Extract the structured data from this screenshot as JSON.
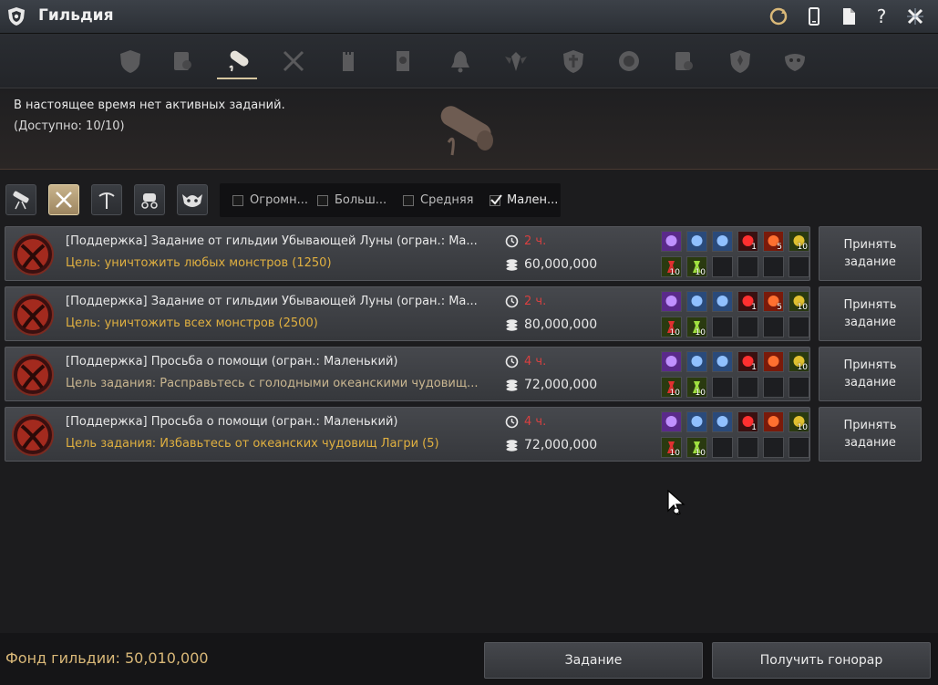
{
  "window": {
    "title": "Гильдия"
  },
  "header": {
    "no_task": "В настоящее время нет активных заданий.",
    "available": "(Доступно: 10/10)"
  },
  "filters": {
    "checkboxes": [
      {
        "label": "Огромн...",
        "checked": false
      },
      {
        "label": "Больш...",
        "checked": false
      },
      {
        "label": "Средняя",
        "checked": false
      },
      {
        "label": "Мален...",
        "checked": true
      }
    ]
  },
  "quests": [
    {
      "name": "[Поддержка] Задание от гильдии Убывающей Луны (огран.: Ма...",
      "goal": "Цель: уничтожить любых монстров (1250)",
      "goal_color": "#e0b040",
      "time": "2 ч.",
      "fee": "60,000,000",
      "counts": [
        "1",
        "5",
        "10",
        "10",
        "10"
      ],
      "accept": "Принять задание"
    },
    {
      "name": "[Поддержка] Задание от гильдии Убывающей Луны (огран.: Ма...",
      "goal": "Цель: уничтожить всех монстров (2500)",
      "goal_color": "#e0b040",
      "time": "2 ч.",
      "fee": "80,000,000",
      "counts": [
        "1",
        "5",
        "10",
        "10",
        "10"
      ],
      "accept": "Принять задание"
    },
    {
      "name": "[Поддержка] Просьба о помощи (огран.: Маленький)",
      "goal": "Цель задания: Расправьтесь с голодными океанскими чудовищ...",
      "goal_color": "#c9b690",
      "time": "4 ч.",
      "fee": "72,000,000",
      "counts": [
        "1",
        "",
        "10",
        "10",
        "10"
      ],
      "accept": "Принять задание"
    },
    {
      "name": "[Поддержка] Просьба о помощи (огран.: Маленький)",
      "goal": "Цель задания: Избавьтесь от океанских чудовищ Лагри (5)",
      "goal_color": "#e0b040",
      "time": "4 ч.",
      "fee": "72,000,000",
      "counts": [
        "1",
        "",
        "10",
        "10",
        "10"
      ],
      "accept": "Принять задание"
    }
  ],
  "footer": {
    "fund": "Фонд гильдии: 50,010,000",
    "task_button": "Задание",
    "fee_button": "Получить гонорар"
  },
  "colors": {
    "accent": "#d9b878",
    "time_red": "#d84040",
    "goal_gold": "#e0b040"
  }
}
